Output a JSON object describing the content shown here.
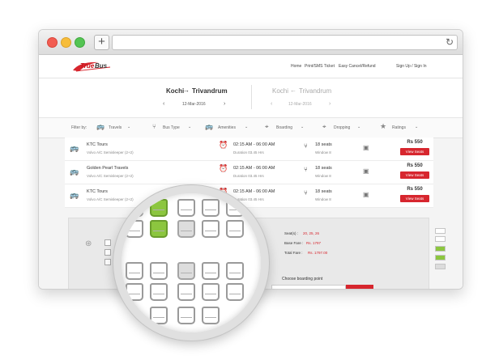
{
  "brand": {
    "logo_text": "True Bus",
    "accent": "#d7262e"
  },
  "nav": {
    "home": "Home",
    "print": "Print/SMS Ticket",
    "cancel": "Easy Cancel/Refund",
    "signup": "Sign Up / Sign In"
  },
  "route": {
    "from": "Kochi",
    "to": "Trivandrum",
    "date": "12-Mar-2016",
    "return_from": "Kochi",
    "return_to": "Trivandrum",
    "return_date": "12-Mar-2016"
  },
  "filters": {
    "label": "Filter by:",
    "items": [
      "Travels",
      "Bus Type",
      "Amenities",
      "Boarding",
      "Dropping",
      "Ratings"
    ]
  },
  "buses": [
    {
      "name": "KTC Tours",
      "type": "Volvo A/C Semisleeper (2+2)",
      "time": "02:15 AM - 06:00 AM",
      "duration": "Duration 03.45 Hrs",
      "seats": "18 seats",
      "window": "Window 8",
      "price": "Rs 550",
      "button": "View Seats"
    },
    {
      "name": "Golden Pearl Travels",
      "type": "Volvo A/C Semisleeper (2+2)",
      "time": "02:15 AM - 06:00 AM",
      "duration": "Duration 03.45 Hrs",
      "seats": "18 seats",
      "window": "Window 8",
      "price": "Rs 550",
      "button": "View Seats"
    },
    {
      "name": "KTC Tours",
      "type": "Volvo A/C Semisleeper (2+2)",
      "time": "02:15 AM - 06:00 AM",
      "duration": "Duration 03.45 Hrs",
      "seats": "18 seats",
      "window": "Window 8",
      "price": "Rs 550",
      "button": "View Seats"
    }
  ],
  "booking": {
    "seats_label": "Seat(s) :",
    "seats_value": "20, 25, 26",
    "base_label": "Base Fare :",
    "base_value": "Rs. 1797",
    "total_label": "Total Fare :",
    "total_value": "Rs. 1797.00",
    "boarding": "Choose boarding point"
  },
  "colors": {
    "selected": "#8cc63f",
    "booked": "#dddddd",
    "available": "#ffffff"
  }
}
